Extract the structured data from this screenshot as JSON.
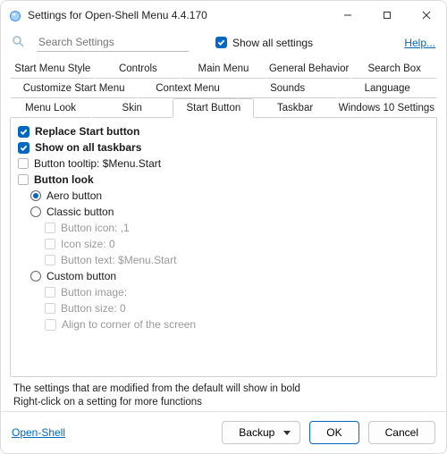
{
  "window": {
    "title": "Settings for Open-Shell Menu 4.4.170"
  },
  "search": {
    "placeholder": "Search Settings",
    "value": "",
    "show_all_label": "Show all settings",
    "help_label": "Help..."
  },
  "tabs": {
    "row1": [
      {
        "label": "Start Menu Style"
      },
      {
        "label": "Controls"
      },
      {
        "label": "Main Menu"
      },
      {
        "label": "General Behavior"
      },
      {
        "label": "Search Box"
      }
    ],
    "row2": [
      {
        "label": "Customize Start Menu"
      },
      {
        "label": "Context Menu"
      },
      {
        "label": "Sounds"
      },
      {
        "label": "Language"
      }
    ],
    "row3": [
      {
        "label": "Menu Look"
      },
      {
        "label": "Skin"
      },
      {
        "label": "Start Button",
        "active": true
      },
      {
        "label": "Taskbar"
      },
      {
        "label": "Windows 10 Settings"
      }
    ]
  },
  "settings": {
    "replace_start": "Replace Start button",
    "show_all_taskbars": "Show on all taskbars",
    "button_tooltip": "Button tooltip: $Menu.Start",
    "button_look": "Button look",
    "aero": "Aero button",
    "classic": "Classic button",
    "classic_icon": "Button icon: ,1",
    "classic_size": "Icon size: 0",
    "classic_text": "Button text: $Menu.Start",
    "custom": "Custom button",
    "custom_image": "Button image:",
    "custom_size": "Button size: 0",
    "custom_align": "Align to corner of the screen"
  },
  "hint": {
    "line1": "The settings that are modified from the default will show in bold",
    "line2": "Right-click on a setting for more functions"
  },
  "footer": {
    "project_link": "Open-Shell",
    "backup": "Backup",
    "ok": "OK",
    "cancel": "Cancel"
  }
}
